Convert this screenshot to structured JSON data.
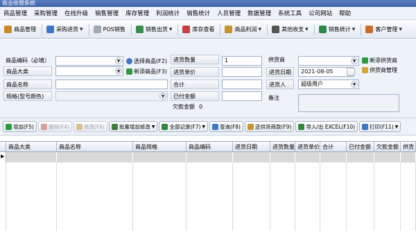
{
  "window": {
    "title": "商业收银系统"
  },
  "menu": [
    "商品管理",
    "采购管理",
    "在线升级",
    "销售管理",
    "库存管理",
    "利润统计",
    "销售统计",
    "人员管理",
    "数据管理",
    "系统工具",
    "公司网站",
    "帮助"
  ],
  "toolbar": [
    {
      "label": "商品管理",
      "icon": "box-icon",
      "color": "#c98a2a",
      "dropdown": false
    },
    {
      "label": "采购进货",
      "icon": "cart-icon",
      "color": "#3f76c7",
      "dropdown": true
    },
    {
      "label": "POS销售",
      "icon": "pos-icon",
      "color": "#a0a8b4",
      "dropdown": false
    },
    {
      "label": "销售出货",
      "icon": "truck-icon",
      "color": "#3a8d4e",
      "dropdown": true
    },
    {
      "label": "库存查看",
      "icon": "house-icon",
      "color": "#c74040",
      "dropdown": false
    },
    {
      "label": "商品利润",
      "icon": "money-bag-icon",
      "color": "#c9922a",
      "dropdown": true
    },
    {
      "label": "其他收支",
      "icon": "pen-icon",
      "color": "#555555",
      "dropdown": true
    },
    {
      "label": "销售统计",
      "icon": "chart-icon",
      "color": "#2f8a4a",
      "dropdown": true
    },
    {
      "label": "客户管理",
      "icon": "people-icon",
      "color": "#c96a2a",
      "dropdown": true
    }
  ],
  "form": {
    "col1_labels": [
      "商品编码（必填）",
      "商品大类",
      "商品名称",
      "规格(型号颜色)"
    ],
    "select_product": "选择商品(F2)",
    "new_product": "新添商品(F3)",
    "col2_labels": [
      "进货数量",
      "进货单价",
      "合计",
      "已付金额",
      "欠款金额"
    ],
    "quantity_value": "1",
    "owed_value": "0",
    "col3_labels": [
      "供货商",
      "进货日期",
      "进货人",
      "备注"
    ],
    "date_value": "2021-08-05",
    "purchaser_value": "超级用户",
    "new_supplier": "新添供货商",
    "supplier_manage": "供货商管理"
  },
  "actions": [
    {
      "label": "增加(F5)",
      "icon": "plus-icon",
      "color": "#2e9a3c",
      "disabled": false,
      "dropdown": false
    },
    {
      "label": "删除(F4)",
      "icon": "delete-icon",
      "color": "#d9a0a0",
      "disabled": true,
      "dropdown": false
    },
    {
      "label": "修改(F6)",
      "icon": "edit-icon",
      "color": "#d8c08a",
      "disabled": true,
      "dropdown": false
    },
    {
      "label": "批量增加修改",
      "icon": "batch-icon",
      "color": "#3b7d3b",
      "disabled": false,
      "dropdown": true
    },
    {
      "label": "全部记录(F7)",
      "icon": "records-icon",
      "color": "#2e8a3c",
      "disabled": false,
      "dropdown": true
    },
    {
      "label": "查询(F8)",
      "icon": "search-icon",
      "color": "#3f76c7",
      "disabled": false,
      "dropdown": false
    },
    {
      "label": "还供货商款(F9)",
      "icon": "money-bag-icon",
      "color": "#c9922a",
      "disabled": false,
      "dropdown": false
    },
    {
      "label": "导入/出 EXCEL(F10)",
      "icon": "excel-icon",
      "color": "#2e8a3c",
      "disabled": false,
      "dropdown": false
    },
    {
      "label": "打印(F11)",
      "icon": "print-icon",
      "color": "#3f76c7",
      "disabled": false,
      "dropdown": true
    }
  ],
  "table": {
    "columns": [
      "商品大类",
      "商品名称",
      "商品规格",
      "商品编码",
      "进货日期",
      "进货数量",
      "进货单价",
      "合计",
      "已付金额",
      "欠款金额",
      "供货"
    ]
  }
}
